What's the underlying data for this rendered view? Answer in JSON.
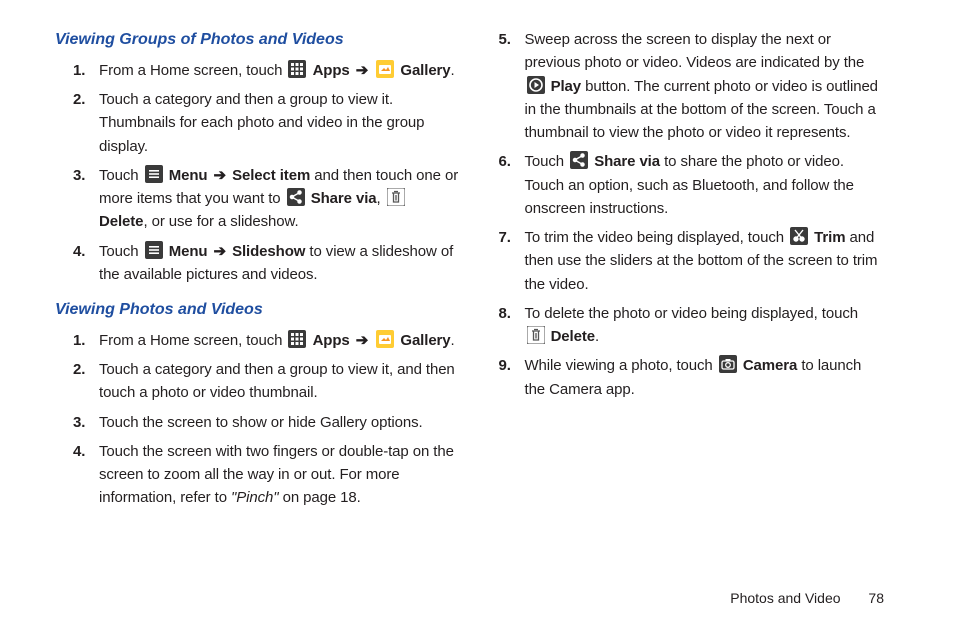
{
  "left": {
    "h1": "Viewing Groups of Photos and Videos",
    "s1_1_a": "From a Home screen, touch",
    "s1_1_b": "Apps",
    "s1_1_c": "Gallery",
    "s1_2": "Touch a category and then a group to view it. Thumbnails for each photo and video in the group display.",
    "s1_3_a": "Touch",
    "s1_3_b": "Menu",
    "s1_3_c": "Select item",
    "s1_3_d": " and then touch one or more items that you want to",
    "s1_3_e": "Share via",
    "s1_3_f": "Delete",
    "s1_3_g": ", or use for a slideshow.",
    "s1_4_a": "Touch",
    "s1_4_b": "Menu",
    "s1_4_c": "Slideshow",
    "s1_4_d": " to view a slideshow of the available pictures and videos.",
    "h2": "Viewing Photos and Videos",
    "s2_1_a": "From a Home screen, touch",
    "s2_1_b": "Apps",
    "s2_1_c": "Gallery",
    "s2_2": "Touch a category and then a group to view it, and then touch a photo or video thumbnail.",
    "s2_3": "Touch the screen to show or hide Gallery options.",
    "s2_4_a": "Touch the screen with two fingers or double-tap on the screen to zoom all the way in or out. For more information, refer to ",
    "s2_4_b": "\"Pinch\"",
    "s2_4_c": " on page 18."
  },
  "right": {
    "s5_a": "Sweep across the screen to display the next or previous photo or video. Videos are indicated by the",
    "s5_b": "Play",
    "s5_c": " button. The current photo or video is outlined in the thumbnails at the bottom of the screen. Touch a thumbnail to view the photo or video it represents.",
    "s6_a": "Touch",
    "s6_b": "Share via",
    "s6_c": " to share the photo or video. Touch an option, such as Bluetooth, and follow the onscreen instructions.",
    "s7_a": "To trim the video being displayed, touch",
    "s7_b": "Trim",
    "s7_c": " and then use the sliders at the bottom of the screen to trim the video.",
    "s8_a": "To delete the photo or video being displayed, touch",
    "s8_b": "Delete",
    "s9_a": "While viewing a photo, touch",
    "s9_b": "Camera",
    "s9_c": " to launch the Camera app."
  },
  "footer": {
    "section": "Photos and Video",
    "page": "78"
  },
  "glyphs": {
    "arrow": "➔"
  }
}
